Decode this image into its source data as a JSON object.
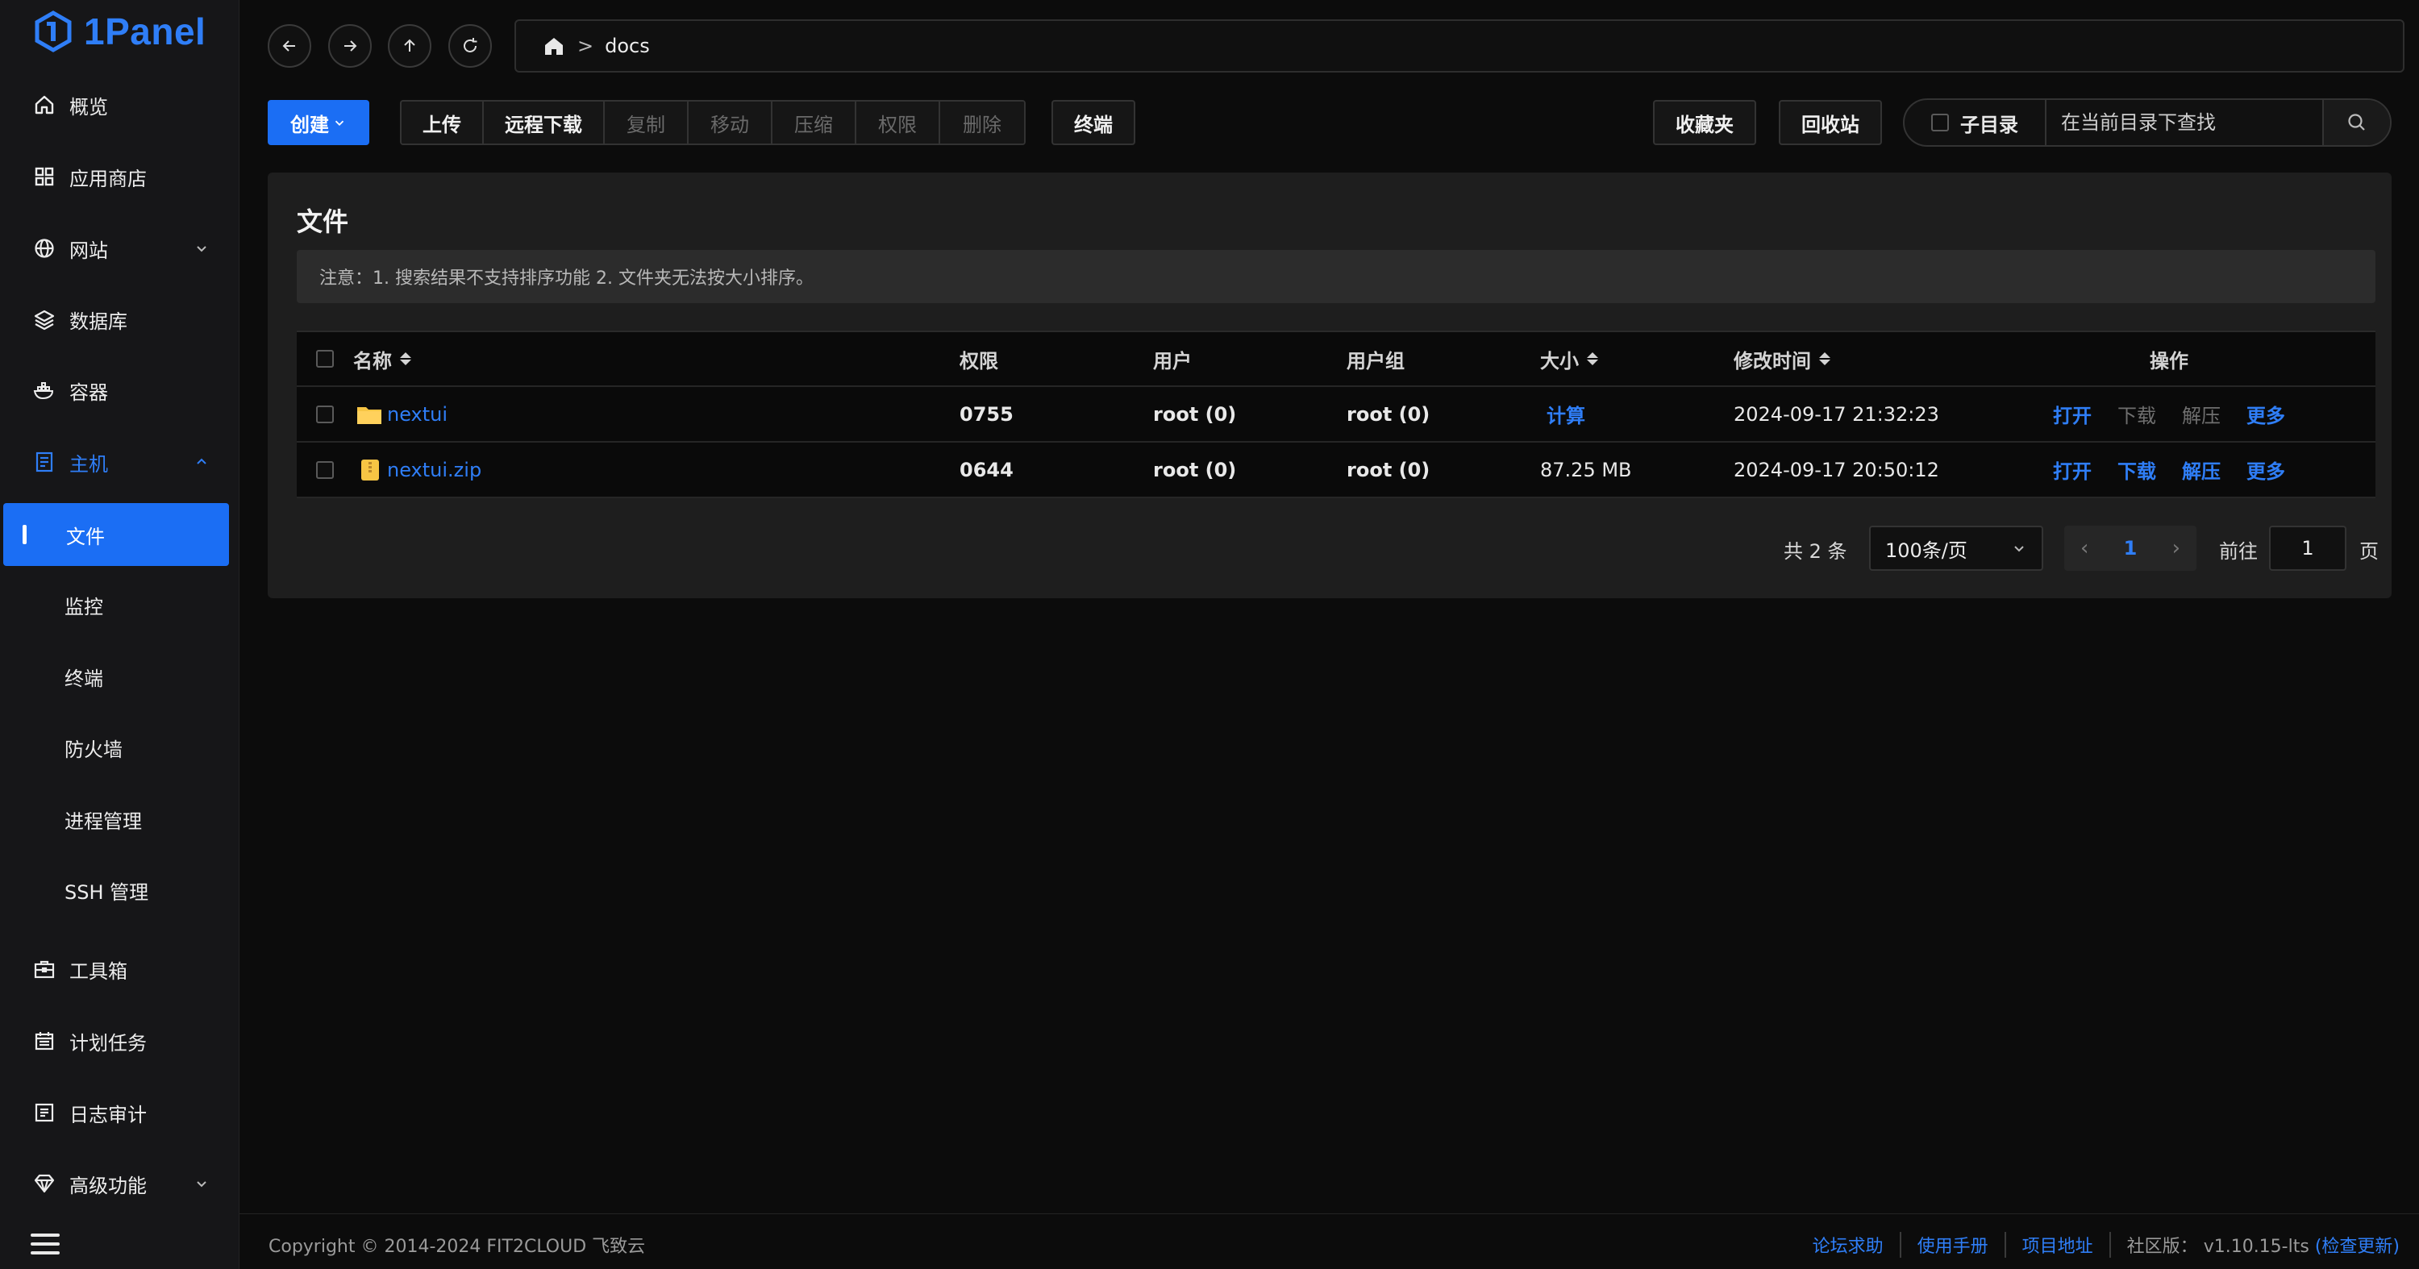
{
  "brand": {
    "name": "1Panel",
    "color": "#2f7ef7"
  },
  "sidebar": {
    "items": [
      {
        "label": "概览",
        "icon": "home-icon"
      },
      {
        "label": "应用商店",
        "icon": "grid-icon"
      },
      {
        "label": "网站",
        "icon": "globe-icon"
      },
      {
        "label": "数据库",
        "icon": "layers-icon"
      },
      {
        "label": "容器",
        "icon": "docker-icon"
      },
      {
        "label": "主机",
        "icon": "server-icon"
      },
      {
        "label": "工具箱",
        "icon": "toolbox-icon"
      },
      {
        "label": "计划任务",
        "icon": "calendar-icon"
      },
      {
        "label": "日志审计",
        "icon": "log-icon"
      },
      {
        "label": "高级功能",
        "icon": "diamond-icon"
      }
    ],
    "host_submenu": [
      "文件",
      "监控",
      "终端",
      "防火墙",
      "进程管理",
      "SSH 管理"
    ],
    "active_submenu": "文件"
  },
  "nav": {
    "path": "docs"
  },
  "toolbar": {
    "create": "创建",
    "upload": "上传",
    "remote_download": "远程下载",
    "copy": "复制",
    "move": "移动",
    "compress": "压缩",
    "permission": "权限",
    "delete": "删除",
    "terminal": "终端",
    "favorites": "收藏夹",
    "recycle_bin": "回收站",
    "subdir": "子目录",
    "search_placeholder": "在当前目录下查找"
  },
  "card": {
    "title": "文件",
    "notice": "注意：1. 搜索结果不支持排序功能 2. 文件夹无法按大小排序。"
  },
  "table": {
    "headers": {
      "name": "名称",
      "permission": "权限",
      "user": "用户",
      "group": "用户组",
      "size": "大小",
      "mtime": "修改时间",
      "actions": "操作"
    },
    "rows": [
      {
        "name": "nextui",
        "type": "folder",
        "permission": "0755",
        "user": "root (0)",
        "group": "root (0)",
        "size": "计算",
        "mtime": "2024-09-17 21:32:23",
        "actions": [
          "打开",
          "下载",
          "解压",
          "更多"
        ]
      },
      {
        "name": "nextui.zip",
        "type": "zip",
        "permission": "0644",
        "user": "root (0)",
        "group": "root (0)",
        "size": "87.25 MB",
        "mtime": "2024-09-17 20:50:12",
        "actions": [
          "打开",
          "下载",
          "解压",
          "更多"
        ]
      }
    ]
  },
  "pagination": {
    "total": "共 2 条",
    "page_size": "100条/页",
    "current": "1",
    "goto_label": "前往",
    "goto_value": "1",
    "page_suffix": "页"
  },
  "footer": {
    "copyright": "Copyright © 2014-2024 FIT2CLOUD 飞致云",
    "links": [
      "论坛求助",
      "使用手册",
      "项目地址"
    ],
    "edition": "社区版：",
    "version": "v1.10.15-lts",
    "check_update": "(检查更新)"
  },
  "colors": {
    "accent": "#1b6ef4",
    "link": "#2f7ef7",
    "background": "#0c0c0c",
    "panel": "#1e1e1e"
  }
}
